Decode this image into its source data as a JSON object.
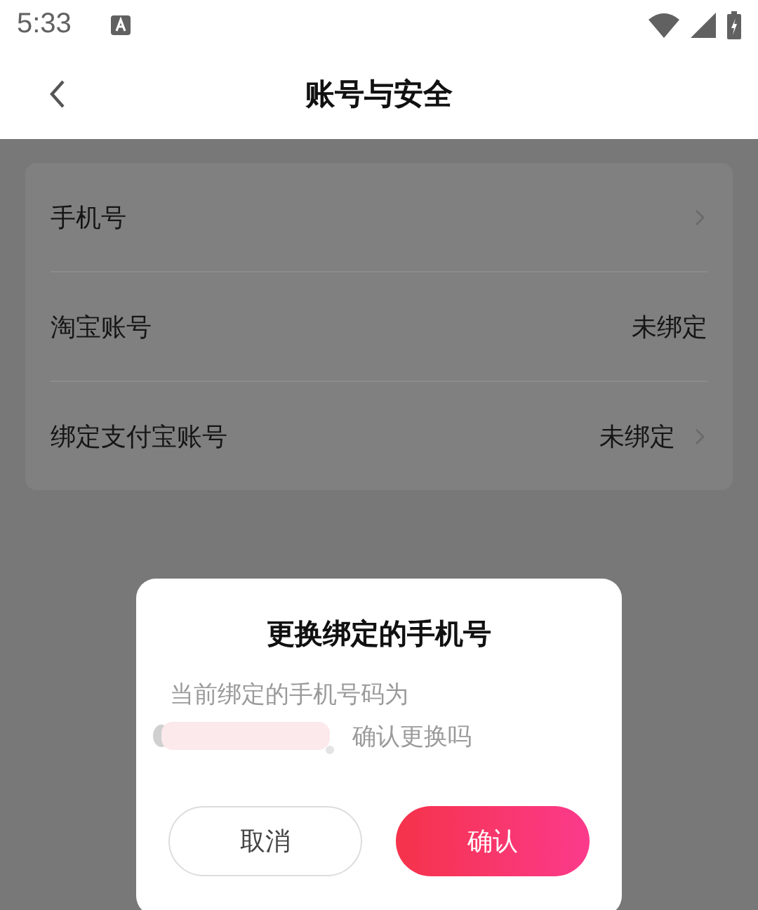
{
  "status_bar": {
    "time": "5:33"
  },
  "header": {
    "title": "账号与安全"
  },
  "rows": [
    {
      "label": "手机号",
      "arrow": true
    },
    {
      "label": "淘宝账号",
      "value": "未绑定",
      "arrow": false
    },
    {
      "label": "绑定支付宝账号",
      "value": "未绑定",
      "arrow": true
    }
  ],
  "dialog": {
    "title": "更换绑定的手机号",
    "message_line_1": "当前绑定的手机号码为",
    "message_line_2": "确认更换吗",
    "buttons": [
      {
        "label": "取消",
        "kind": "secondary"
      },
      {
        "label": "确认",
        "kind": "primary"
      }
    ]
  }
}
